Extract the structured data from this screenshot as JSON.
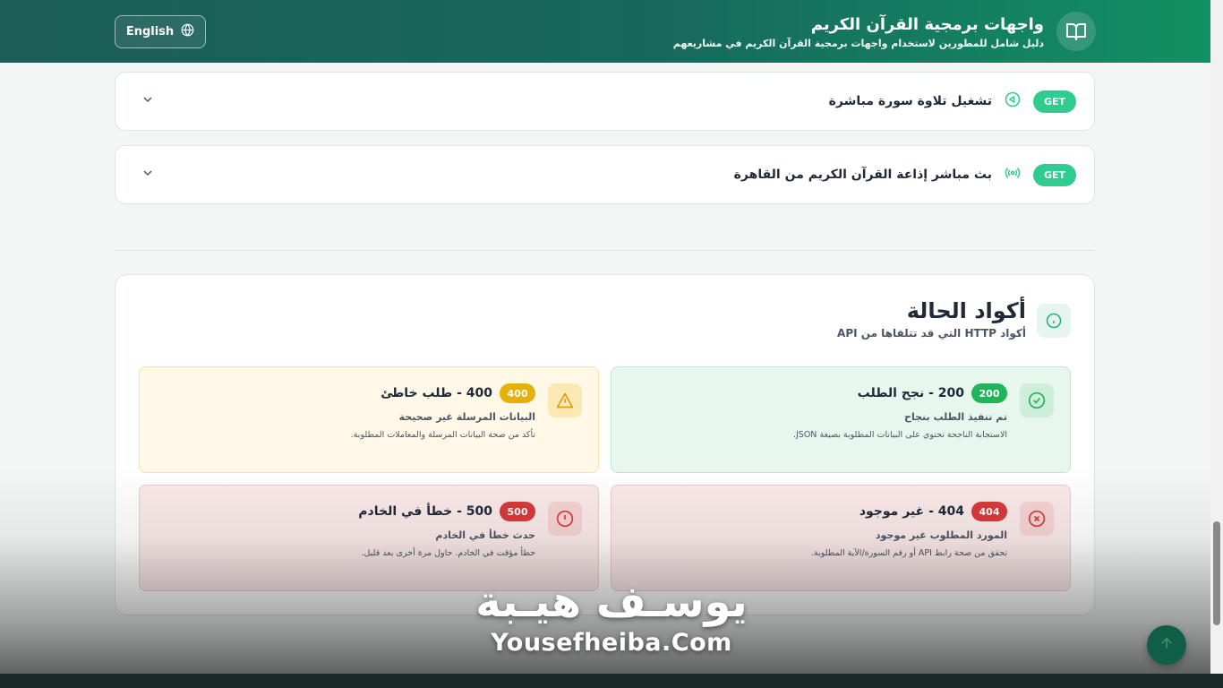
{
  "header": {
    "title": "واجهات برمجية القرآن الكريم",
    "subtitle": "دليل شامل للمطورين لاستخدام واجهات برمجية القرآن الكريم في مشاريعهم",
    "language_label": "English"
  },
  "endpoints": [
    {
      "method": "GET",
      "title": "تشغيل تلاوة سورة مباشرة",
      "icon": "play-circle-icon"
    },
    {
      "method": "GET",
      "title": "بث مباشر إذاعة القرآن الكريم من القاهرة",
      "icon": "radio-broadcast-icon"
    }
  ],
  "status_section": {
    "title": "أكواد الحالة",
    "subtitle": "أكواد HTTP التي قد تتلقاها من API",
    "cards": [
      {
        "code": "200",
        "title": "200 - نجح الطلب",
        "desc": "تم تنفيذ الطلب بنجاح",
        "note": "الاستجابة الناجحة تحتوي على البيانات المطلوبة بصيغة JSON.",
        "color": "#22b45a",
        "icon": "check-circle-icon"
      },
      {
        "code": "400",
        "title": "400 - طلب خاطئ",
        "desc": "البيانات المرسلة غير صحيحة",
        "note": "تأكد من صحة البيانات المرسلة والمعاملات المطلوبة.",
        "color": "#e5b008",
        "icon": "warning-triangle-icon"
      },
      {
        "code": "404",
        "title": "404 - غير موجود",
        "desc": "المورد المطلوب غير موجود",
        "note": "تحقق من صحة رابط API أو رقم السورة/الآية المطلوبة.",
        "color": "#d83a3a",
        "icon": "x-circle-icon"
      },
      {
        "code": "500",
        "title": "500 - خطأ في الخادم",
        "desc": "حدث خطأ في الخادم",
        "note": "خطأ مؤقت في الخادم. حاول مرة أخرى بعد قليل.",
        "color": "#d83a3a",
        "icon": "alert-circle-icon"
      }
    ]
  },
  "watermark": {
    "arabic": "يوسـف هيـبة",
    "latin": "Yousefheiba.Com"
  },
  "colors": {
    "header_start": "#1d5c57",
    "header_end": "#119063",
    "accent": "#2ecc8f"
  }
}
